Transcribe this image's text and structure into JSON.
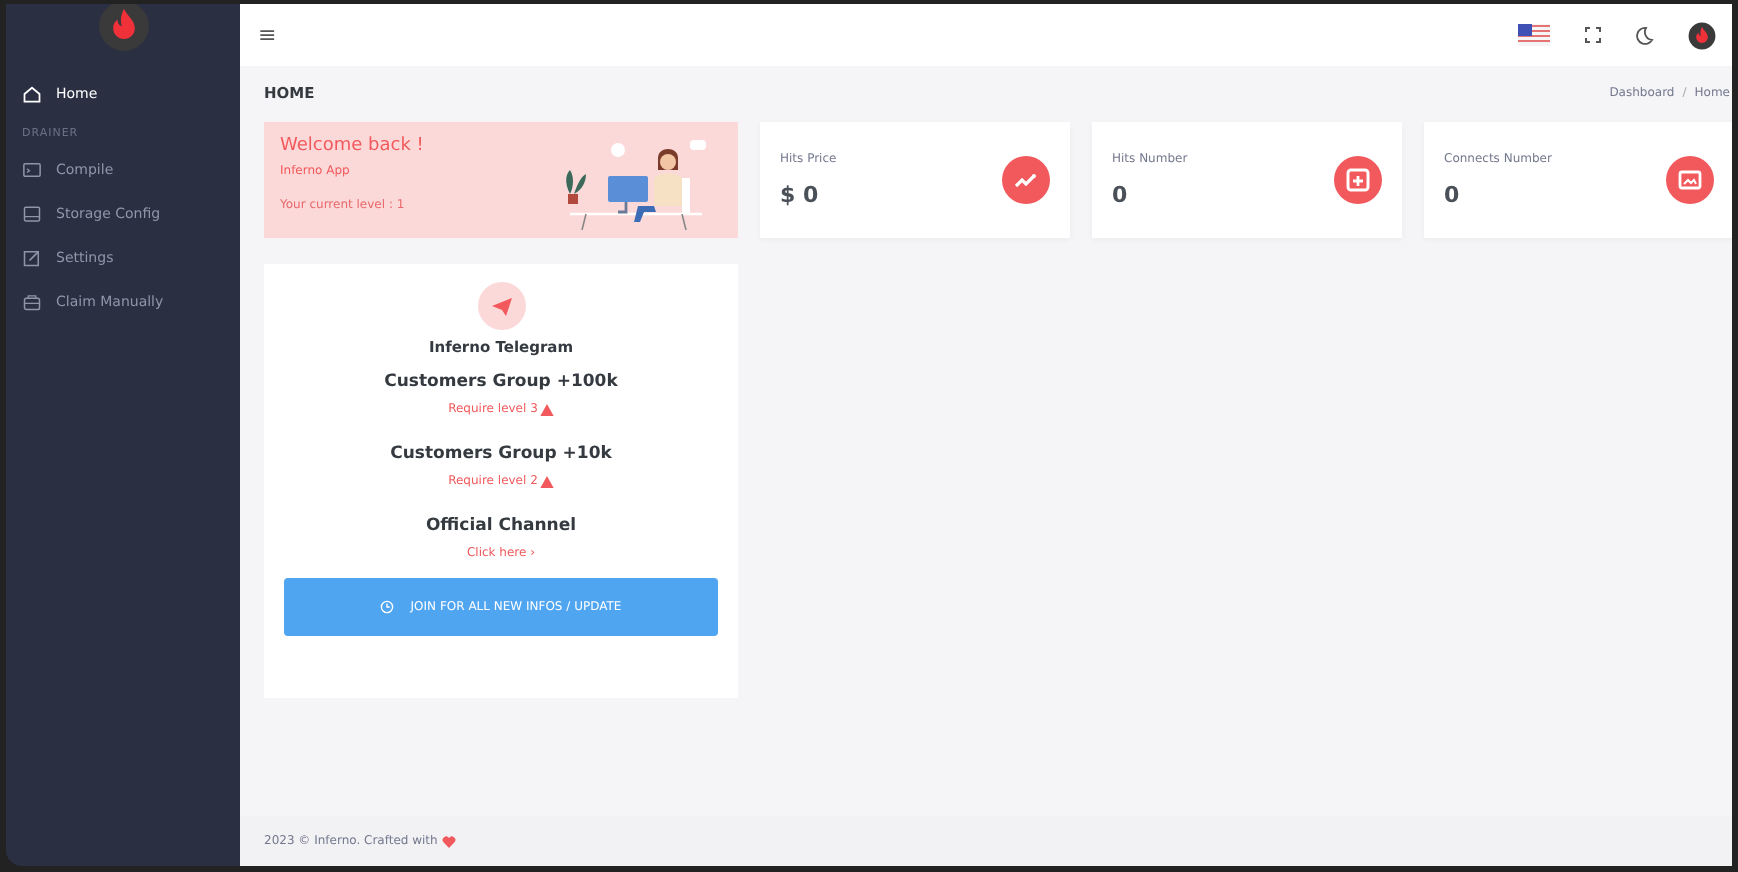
{
  "sidebar": {
    "items": [
      {
        "kind": "link",
        "label": "Home",
        "selected": true
      },
      {
        "kind": "heading",
        "label": "DRAINER"
      },
      {
        "kind": "link",
        "label": "Compile",
        "selected": false
      },
      {
        "kind": "link",
        "label": "Storage Config",
        "selected": false
      },
      {
        "kind": "link",
        "label": "Settings",
        "selected": false
      },
      {
        "kind": "link",
        "label": "Claim Manually",
        "selected": false
      }
    ]
  },
  "topbar": {
    "menu_glyph": "≡"
  },
  "page": {
    "title": "HOME",
    "breadcrumb": [
      "Dashboard",
      "Home"
    ],
    "breadcrumb_separator": "/"
  },
  "welcome": {
    "title": "Welcome back !",
    "app": "Inferno App",
    "level_text": "Your current level : 1"
  },
  "stats": [
    {
      "label": "Hits Price",
      "value": "$ 0"
    },
    {
      "label": "Hits Number",
      "value": "0"
    },
    {
      "label": "Connects Number",
      "value": "0"
    }
  ],
  "telegram": {
    "title": "Inferno Telegram",
    "groups": [
      {
        "kind": "locked",
        "name": "Customers Group +100k",
        "note": "Require level 3"
      },
      {
        "kind": "locked",
        "name": "Customers Group +10k",
        "note": "Require level 2"
      },
      {
        "kind": "link",
        "name": "Official Channel",
        "note": "Click here ›"
      }
    ],
    "button": "JOIN FOR ALL NEW INFOS / UPDATE"
  },
  "footer": "2023 © Inferno. Crafted with"
}
